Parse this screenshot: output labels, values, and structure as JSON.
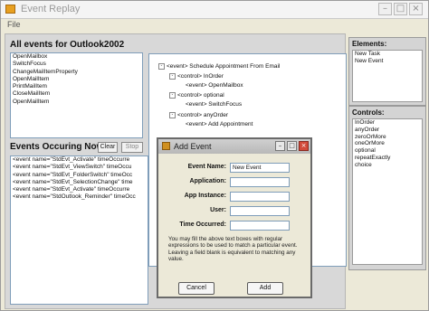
{
  "window": {
    "title": "Event Replay"
  },
  "menu": {
    "file": "File"
  },
  "events_panel": {
    "title": "All events for Outlook2002",
    "items": [
      "OpenMailbox",
      "SwitchFocus",
      "ChangeMailItemProperty",
      "OpenMailItem",
      "PrintMailItem",
      "CloseMailItem",
      "OpenMailItem"
    ]
  },
  "occurring": {
    "title": "Events Occuring Now",
    "clear_label": "Clear",
    "stop_label": "Stop",
    "rows": [
      "<event name=\"StdEvt_Activate\" timeOccurre",
      "<event name=\"StdEvt_ViewSwitch\" timeOccu",
      "<event name=\"StdEvt_FolderSwitch\" timeOcc",
      "<event name=\"StdEvt_SelectionChange\" time",
      "<event name=\"StdEvt_Activate\" timeOccurre",
      "<event name=\"StdOutlook_Reminder\" timeOcc"
    ]
  },
  "tree": {
    "root": "<event> Schedule Appointment From Email",
    "n1": "<control> InOrder",
    "n1a": "<event> OpenMailbox",
    "n2": "<control> optional",
    "n2a": "<event> SwitchFocus",
    "n3": "<control> anyOrder",
    "n3a": "<event> Add Appointment"
  },
  "elements": {
    "title": "Elements:",
    "items": [
      "New Task",
      "New Event"
    ]
  },
  "controls": {
    "title": "Controls:",
    "items": [
      "InOrder",
      "anyOrder",
      "zeroOrMore",
      "oneOrMore",
      "optional",
      "repeatExactly",
      "choice"
    ]
  },
  "dialog": {
    "title": "Add Event",
    "fields": [
      {
        "label": "Event Name:",
        "value": "New Event"
      },
      {
        "label": "Application:",
        "value": ""
      },
      {
        "label": "App Instance:",
        "value": ""
      },
      {
        "label": "User:",
        "value": ""
      },
      {
        "label": "Time Occurred:",
        "value": ""
      }
    ],
    "description": "You may fill the above text boxes with regular expressions to be used to match a particular event. Leaving a field blank is equivalent to matching any value.",
    "cancel_label": "Cancel",
    "add_label": "Add"
  }
}
